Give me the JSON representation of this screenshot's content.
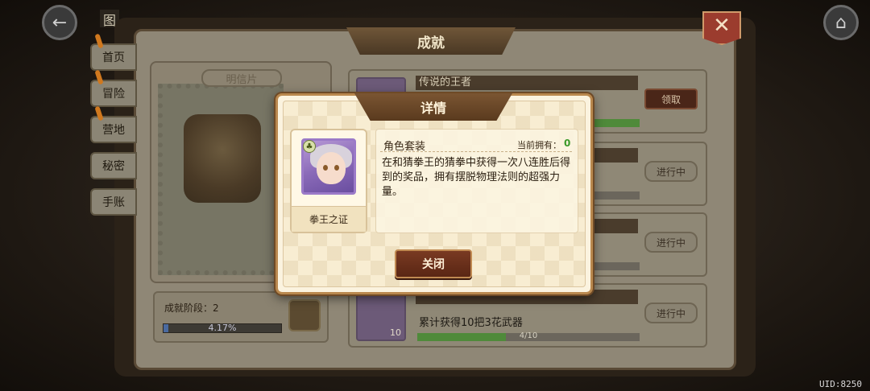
{
  "topbar": {
    "page_label": "图"
  },
  "book": {
    "title": "成就",
    "close_glyph": "✕"
  },
  "side_tabs": [
    {
      "label": "首页"
    },
    {
      "label": "冒险"
    },
    {
      "label": "营地"
    },
    {
      "label": "秘密"
    },
    {
      "label": "手账"
    }
  ],
  "postcard": {
    "label": "明信片",
    "stage_label": "成就阶段：2",
    "stage_progress_text": "4.17%",
    "stage_progress": 0.0417
  },
  "achievements": [
    {
      "title": "传说的王者",
      "desc": "",
      "progress_text": "",
      "progress": 1.0,
      "button": "领取",
      "icon_count": ""
    },
    {
      "title": "",
      "desc": "",
      "progress_text": "",
      "progress": 0.0,
      "button": "进行中",
      "icon_count": ""
    },
    {
      "title": "",
      "desc": "",
      "progress_text": "",
      "progress": 0.0,
      "button": "进行中",
      "icon_count": ""
    },
    {
      "title": "",
      "desc": "累计获得10把3花武器",
      "progress_text": "4/10",
      "progress": 0.4,
      "button": "进行中",
      "icon_count": "10"
    }
  ],
  "modal": {
    "title": "详情",
    "item_name": "拳王之证",
    "item_type": "角色套装",
    "owned_label": "当前拥有：",
    "owned_value": "0",
    "description": "在和猜拳王的猜拳中获得一次八连胜后得到的奖品，拥有摆脱物理法则的超强力量。",
    "close_button": "关闭"
  },
  "footer": {
    "uid": "UID:8250"
  },
  "colors": {
    "accent_brown": "#7a3a22",
    "owned_green": "#3a9a2a",
    "progress_green": "#4f8a3a",
    "stage_blue": "#4a6aa0"
  },
  "icons": [
    "back-arrow-icon",
    "home-icon",
    "close-x-icon",
    "chest-icon",
    "clover-icon"
  ]
}
